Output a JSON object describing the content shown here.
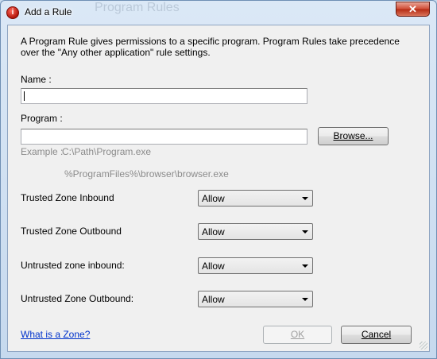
{
  "window": {
    "title": "Add a Rule",
    "background_title": "Program Rules",
    "close_symbol": "✕",
    "app_icon": "zonealarm-icon"
  },
  "dialog": {
    "description": "A Program Rule gives permissions to a specific program. Program Rules take precedence over the \"Any other application\" rule settings.",
    "name_label": "Name :",
    "name_value": "",
    "program_label": "Program :",
    "program_value": "",
    "browse_label": "Browse...",
    "example_label": "Example :",
    "example_1": "C:\\Path\\Program.exe",
    "example_2": "%ProgramFiles%\\browser\\browser.exe",
    "zones": [
      {
        "label": "Trusted Zone Inbound",
        "value": "Allow"
      },
      {
        "label": "Trusted Zone Outbound",
        "value": "Allow"
      },
      {
        "label": "Untrusted zone inbound:",
        "value": "Allow"
      },
      {
        "label": "Untrusted Zone Outbound:",
        "value": "Allow"
      }
    ],
    "help_link": "What is a Zone?",
    "ok_label": "OK",
    "cancel_label": "Cancel"
  },
  "colors": {
    "frame": "#c6d9ee",
    "client": "#f0f0f0",
    "link": "#0033cc",
    "disabled_text": "#a0a0a0",
    "close": "#c9432d"
  }
}
